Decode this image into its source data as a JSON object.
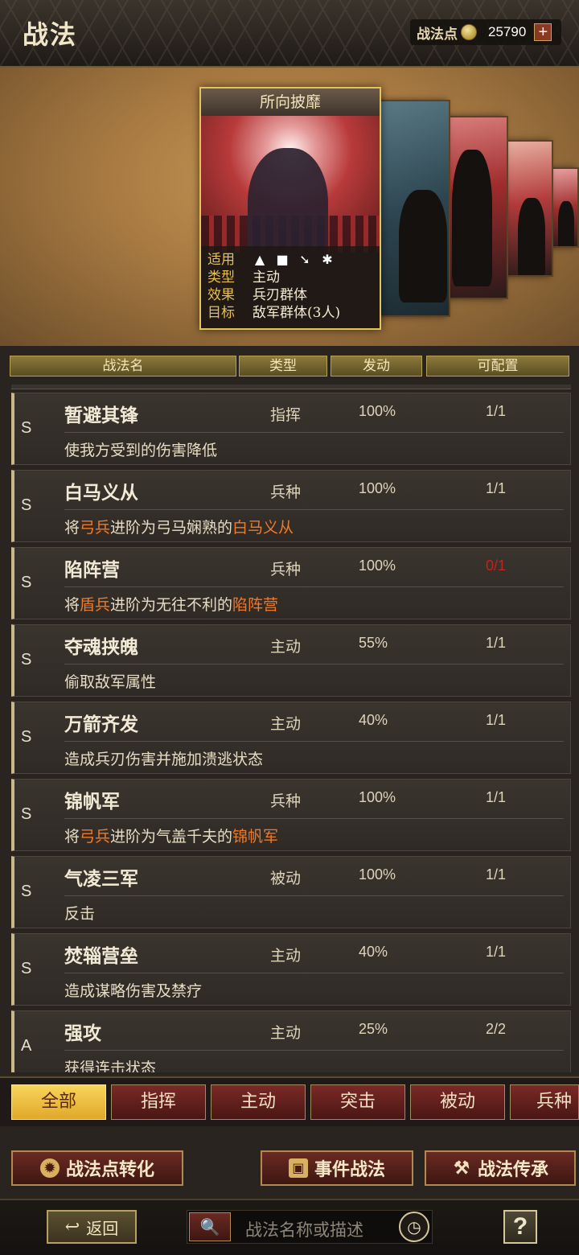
{
  "header": {
    "title": "战法",
    "points_label": "战法点",
    "points_value": "25790",
    "plus_label": "+"
  },
  "card": {
    "title": "所向披靡",
    "labels": {
      "applicable": "适用",
      "type": "类型",
      "effect": "效果",
      "target": "目标"
    },
    "type_value": "主动",
    "effect_value": "兵刃群体",
    "target_value": "敌军群体(3人)",
    "unit_icons": [
      "cavalry-icon",
      "shield-icon",
      "bow-icon",
      "wheel-icon"
    ]
  },
  "table_headers": {
    "name": "战法名",
    "type": "类型",
    "rate": "发动",
    "config": "可配置"
  },
  "rows": [
    {
      "grade": "S",
      "name": "暂避其锋",
      "type": "指挥",
      "rate": "100%",
      "config": "1/1",
      "desc_parts": [
        "使我方受到的伤害降低"
      ]
    },
    {
      "grade": "S",
      "name": "白马义从",
      "type": "兵种",
      "rate": "100%",
      "config": "1/1",
      "desc_parts": [
        "将",
        "弓兵",
        "进阶为弓马娴熟的",
        "白马义从"
      ]
    },
    {
      "grade": "S",
      "name": "陷阵营",
      "type": "兵种",
      "rate": "100%",
      "config": "0/1",
      "desc_parts": [
        "将",
        "盾兵",
        "进阶为无往不利的",
        "陷阵营"
      ]
    },
    {
      "grade": "S",
      "name": "夺魂挟魄",
      "type": "主动",
      "rate": "55%",
      "config": "1/1",
      "desc_parts": [
        "偷取敌军属性"
      ]
    },
    {
      "grade": "S",
      "name": "万箭齐发",
      "type": "主动",
      "rate": "40%",
      "config": "1/1",
      "desc_parts": [
        "造成兵刃伤害并施加溃逃状态"
      ]
    },
    {
      "grade": "S",
      "name": "锦帆军",
      "type": "兵种",
      "rate": "100%",
      "config": "1/1",
      "desc_parts": [
        "将",
        "弓兵",
        "进阶为气盖千夫的",
        "锦帆军"
      ]
    },
    {
      "grade": "S",
      "name": "气凌三军",
      "type": "被动",
      "rate": "100%",
      "config": "1/1",
      "desc_parts": [
        "反击"
      ]
    },
    {
      "grade": "S",
      "name": "焚辎营垒",
      "type": "主动",
      "rate": "40%",
      "config": "1/1",
      "desc_parts": [
        "造成谋略伤害及禁疗"
      ]
    },
    {
      "grade": "A",
      "name": "强攻",
      "type": "主动",
      "rate": "25%",
      "config": "2/2",
      "desc_parts": [
        "获得连击状态"
      ]
    }
  ],
  "tabs": [
    "全部",
    "指挥",
    "主动",
    "突击",
    "被动",
    "兵种"
  ],
  "actions": {
    "convert": "战法点转化",
    "event": "事件战法",
    "inherit": "战法传承"
  },
  "bottom": {
    "back": "返回",
    "search_placeholder": "战法名称或描述",
    "help": "?"
  },
  "colors": {
    "highlight": "#f07a2a",
    "warning": "#c8201c",
    "active_tab": "#f8d45a",
    "card_border": "#e4c45a"
  }
}
